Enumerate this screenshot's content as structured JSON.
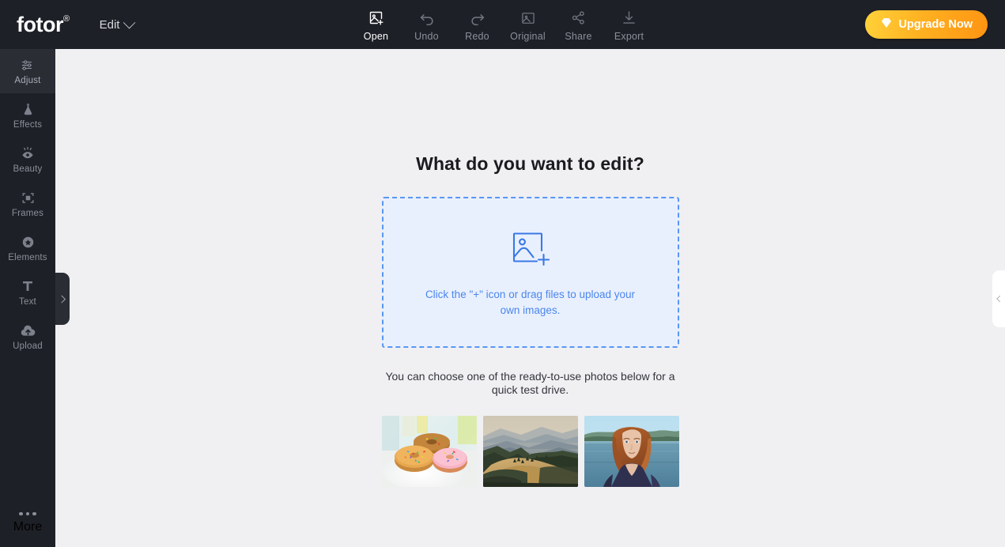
{
  "header": {
    "logo": "fotor",
    "logo_mark": "®",
    "edit_label": "Edit",
    "tools": [
      {
        "label": "Open",
        "icon": "image-plus-icon",
        "active": true
      },
      {
        "label": "Undo",
        "icon": "undo-arrow-icon",
        "active": false
      },
      {
        "label": "Redo",
        "icon": "redo-arrow-icon",
        "active": false
      },
      {
        "label": "Original",
        "icon": "image-icon",
        "active": false
      },
      {
        "label": "Share",
        "icon": "share-nodes-icon",
        "active": false
      },
      {
        "label": "Export",
        "icon": "download-icon",
        "active": false
      }
    ],
    "upgrade_label": "Upgrade Now",
    "upgrade_icon": "diamond-icon"
  },
  "sidebar": {
    "items": [
      {
        "label": "Adjust",
        "icon": "sliders-icon",
        "active": true
      },
      {
        "label": "Effects",
        "icon": "flask-icon",
        "active": false
      },
      {
        "label": "Beauty",
        "icon": "eye-icon",
        "active": false
      },
      {
        "label": "Frames",
        "icon": "frame-icon",
        "active": false
      },
      {
        "label": "Elements",
        "icon": "star-badge-icon",
        "active": false
      },
      {
        "label": "Text",
        "icon": "text-t-icon",
        "active": false
      },
      {
        "label": "Upload",
        "icon": "cloud-upload-icon",
        "active": false
      }
    ],
    "more_label": "More",
    "more_icon": "ellipsis-icon"
  },
  "main": {
    "title": "What do you want to edit?",
    "dropzone": {
      "icon": "image-add-icon",
      "text": "Click the \"+\" icon or drag files to upload your own images."
    },
    "subtext": "You can choose one of the ready-to-use photos below for a quick test drive.",
    "samples": [
      {
        "name": "donuts-photo",
        "alt": "Three frosted donuts with sprinkles on a white plate"
      },
      {
        "name": "landscape-photo",
        "alt": "Golden hillside with pine trees and misty blue mountain ridges"
      },
      {
        "name": "portrait-photo",
        "alt": "Red-haired woman in navy top in front of a blue lake"
      }
    ]
  },
  "panels": {
    "left_handle_icon": "chevron-right-icon",
    "right_handle_icon": "chevron-left-icon"
  },
  "colors": {
    "header_bg": "#1e2027",
    "canvas_bg": "#f0f0f2",
    "accent_blue": "#4a86ee",
    "dropzone_fill": "#e9f0fd",
    "upgrade_from": "#ffd23a",
    "upgrade_to": "#ff9412"
  }
}
